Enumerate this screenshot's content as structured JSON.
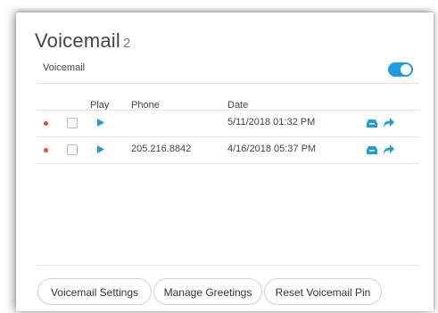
{
  "header": {
    "title": "Voicemail",
    "count": "2"
  },
  "toggle": {
    "label": "Voicemail",
    "enabled": true
  },
  "table": {
    "columns": [
      "Play",
      "Phone",
      "Date"
    ],
    "rows": [
      {
        "phone": "",
        "date": "5/11/2018 01:32 PM",
        "unread": true
      },
      {
        "phone": "205.216.8842",
        "date": "4/16/2018 05:37 PM",
        "unread": true
      }
    ]
  },
  "buttons": {
    "settings": "Voicemail Settings",
    "greetings": "Manage Greetings",
    "reset_pin": "Reset Voicemail Pin"
  },
  "colors": {
    "accent": "#1f9be0",
    "unread_dot": "#e44d3a"
  },
  "icons": {
    "play": "play-icon",
    "archive": "archive-icon",
    "forward": "forward-icon"
  }
}
